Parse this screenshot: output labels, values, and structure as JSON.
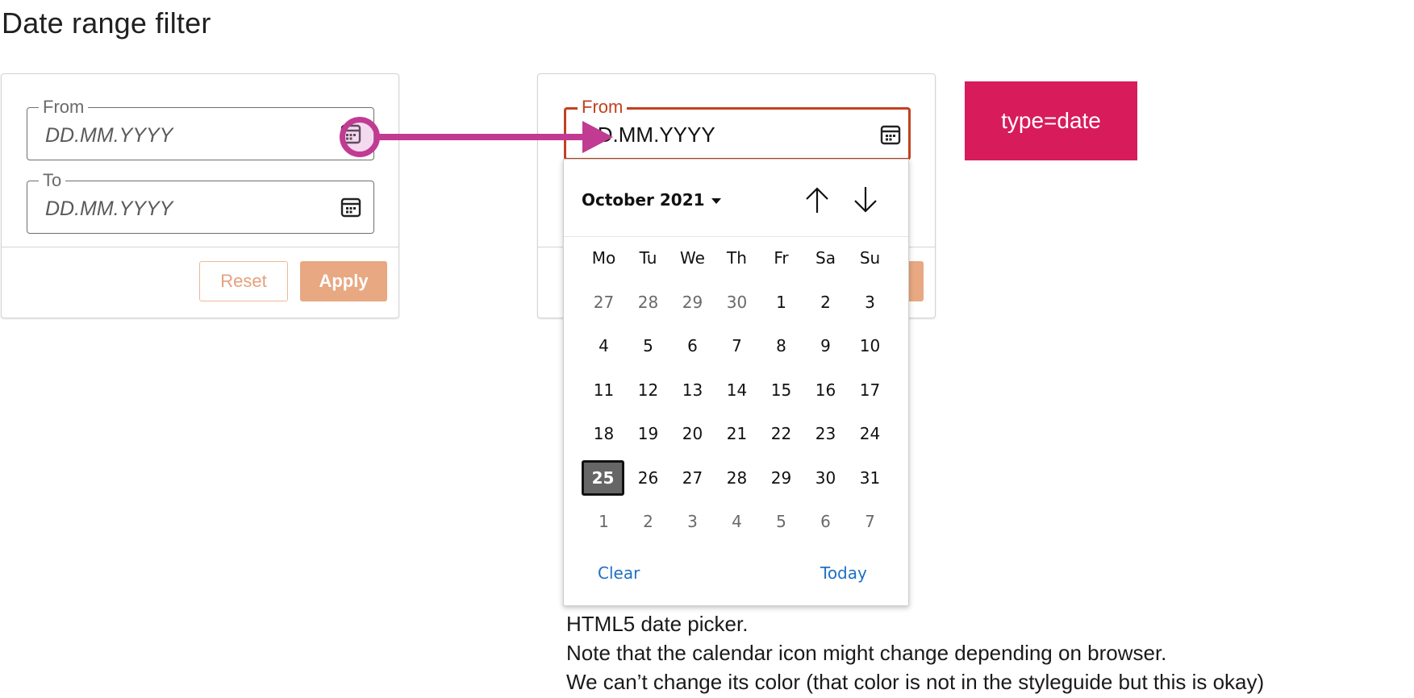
{
  "page_title": "Date range filter",
  "left_panel": {
    "from": {
      "legend": "From",
      "placeholder": "DD.MM.YYYY"
    },
    "to": {
      "legend": "To",
      "placeholder": "DD.MM.YYYY"
    },
    "reset_label": "Reset",
    "apply_label": "Apply"
  },
  "right_panel": {
    "from": {
      "legend": "From",
      "value": "DD.MM.YYYY"
    }
  },
  "tag_label": "type=date",
  "picker": {
    "month_label": "October 2021",
    "weekdays": [
      "Mo",
      "Tu",
      "We",
      "Th",
      "Fr",
      "Sa",
      "Su"
    ],
    "weeks": [
      [
        "27",
        "28",
        "29",
        "30",
        "1",
        "2",
        "3"
      ],
      [
        "4",
        "5",
        "6",
        "7",
        "8",
        "9",
        "10"
      ],
      [
        "11",
        "12",
        "13",
        "14",
        "15",
        "16",
        "17"
      ],
      [
        "18",
        "19",
        "20",
        "21",
        "22",
        "23",
        "24"
      ],
      [
        "25",
        "26",
        "27",
        "28",
        "29",
        "30",
        "31"
      ],
      [
        "1",
        "2",
        "3",
        "4",
        "5",
        "6",
        "7"
      ]
    ],
    "selected_day": "25",
    "clear_label": "Clear",
    "today_label": "Today"
  },
  "notes": {
    "line1": "HTML5 date picker.",
    "line2": "Note that the calendar icon might change depending on browser.",
    "line3": "We can’t change its color (that color is not in the styleguide but this is okay)"
  },
  "colors": {
    "accent": "#c2411f",
    "apply_bg": "#e8a882",
    "tag_bg": "#d81b5a",
    "highlight": "#c13b92",
    "link": "#1f6fc4"
  },
  "icons": [
    "calendar-icon",
    "arrow-up-icon",
    "arrow-down-icon",
    "caret-down-icon"
  ]
}
